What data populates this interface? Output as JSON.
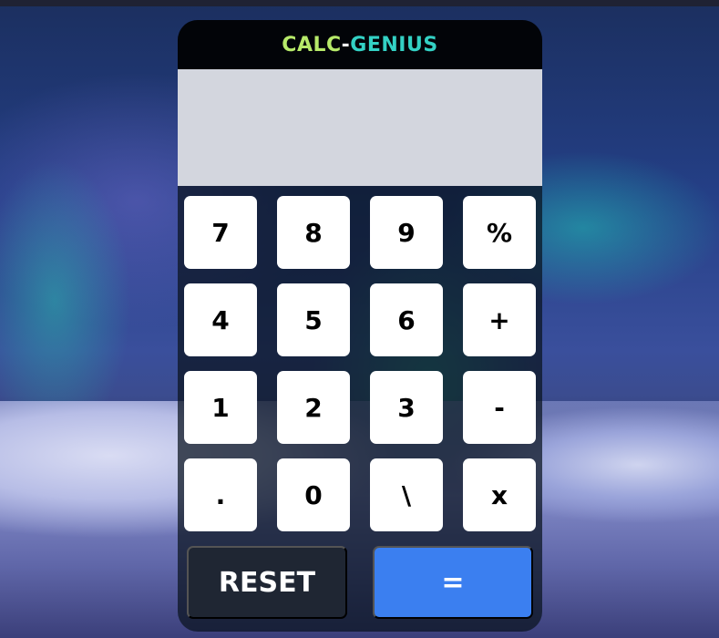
{
  "app": {
    "title_part1": "CALC",
    "title_sep": "-",
    "title_part2": "GENIUS"
  },
  "display": {
    "value": ""
  },
  "keys": [
    [
      "7",
      "8",
      "9",
      "%"
    ],
    [
      "4",
      "5",
      "6",
      "+"
    ],
    [
      "1",
      "2",
      "3",
      "-"
    ],
    [
      ".",
      "0",
      "\\",
      "x"
    ]
  ],
  "actions": {
    "reset_label": "RESET",
    "equals_label": "="
  },
  "colors": {
    "title_part1": "#b7ea6a",
    "title_part2": "#33d1c4",
    "display_bg": "#d3d6de",
    "equals_bg": "#3b7ff0",
    "reset_bg": "#1f2633"
  }
}
